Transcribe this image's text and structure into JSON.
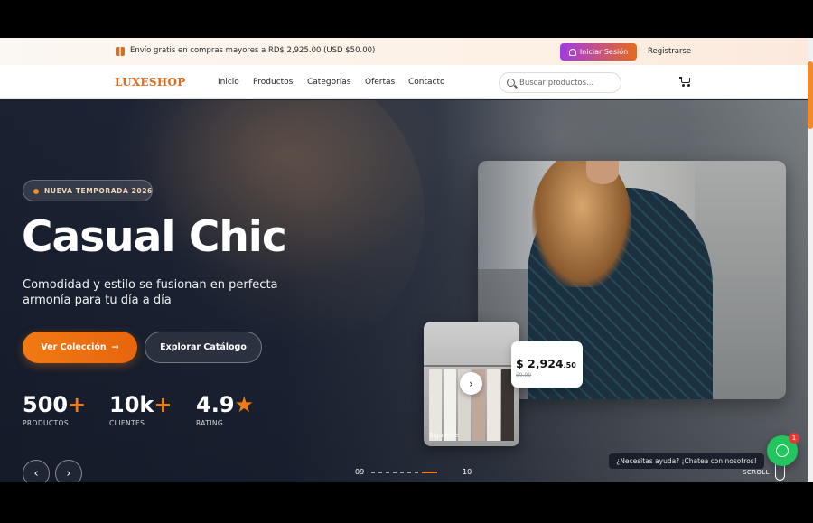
{
  "promo": {
    "text": "Envío gratis en compras mayores a RD$ 2,925.00 (USD $50.00)",
    "login_label": "Iniciar Sesión",
    "register_label": "Registrarse"
  },
  "nav": {
    "logo": "LUXESHOP",
    "links": [
      "Inicio",
      "Productos",
      "Categorías",
      "Ofertas",
      "Contacto"
    ],
    "search_placeholder": "Buscar productos..."
  },
  "hero": {
    "badge": "NUEVA TEMPORADA 2026",
    "title": "Casual Chic",
    "subtitle": "Comodidad y estilo se fusionan en perfecta armonía para tu día a día",
    "primary_button": "Ver Colección",
    "secondary_button": "Explorar Catálogo",
    "stats": [
      {
        "value": "500",
        "accent": "+",
        "label": "PRODUCTOS"
      },
      {
        "value": "10k",
        "accent": "+",
        "label": "CLIENTES"
      },
      {
        "value": "4.9",
        "accent": "★",
        "label": "RATING"
      }
    ],
    "pager": {
      "current": "09",
      "next": "10",
      "dots": 8,
      "active_index": 7
    },
    "price": {
      "main": "$ 2,924",
      "cents": ".50",
      "old": "59.99"
    },
    "next_label": "Siguiente"
  },
  "chat": {
    "tooltip": "¿Necesitas ayuda? ¡Chatea con nosotros!",
    "badge_count": "1",
    "scroll_label": "SCROLL"
  },
  "colors": {
    "accent": "#f07a14",
    "login_gradient_start": "#a23be6",
    "whatsapp": "#22c55e"
  }
}
